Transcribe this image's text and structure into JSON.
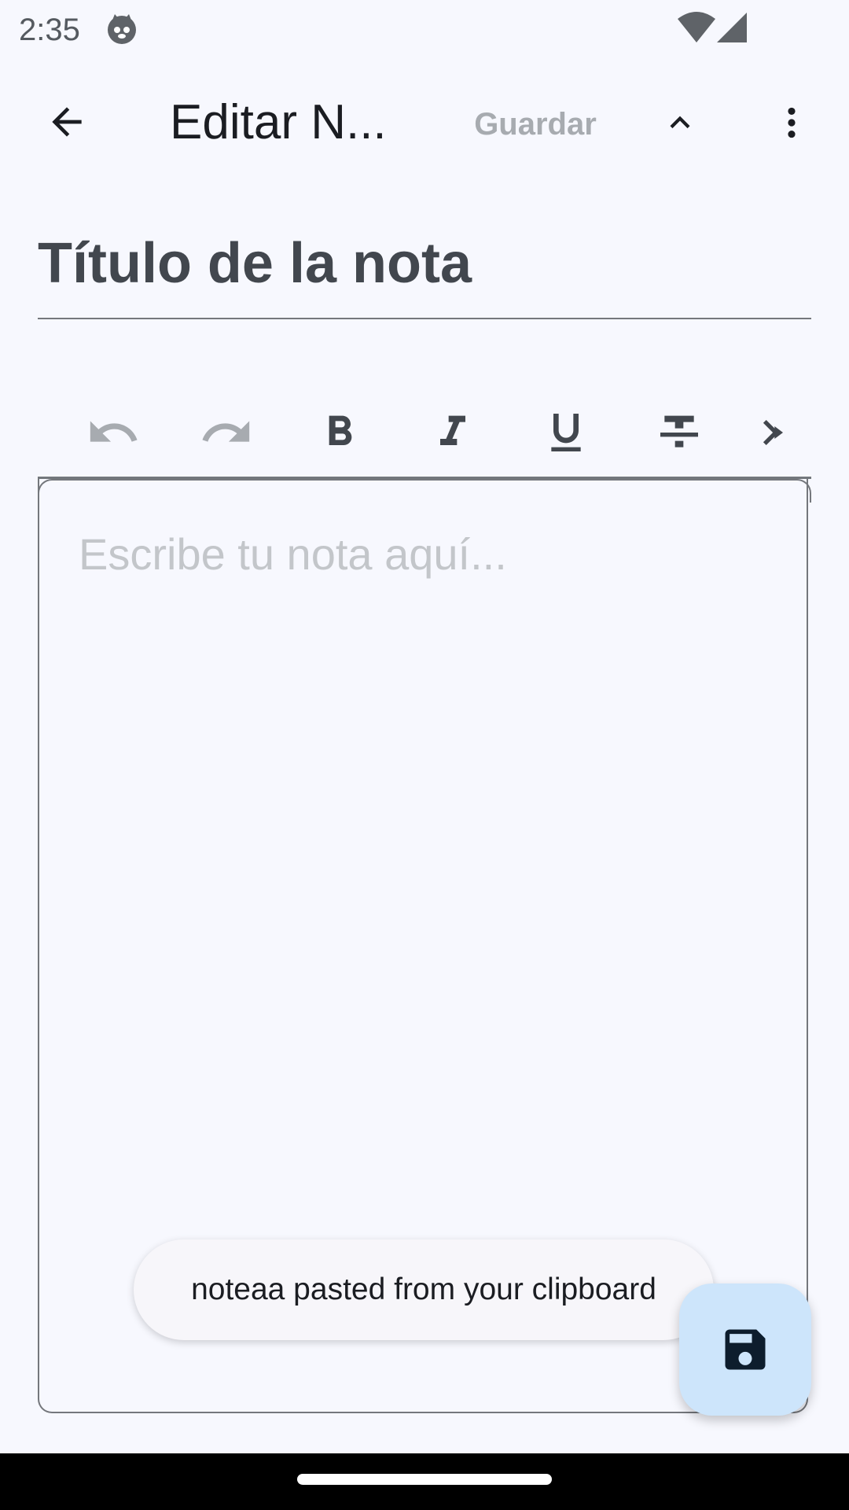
{
  "status_bar": {
    "time": "2:35",
    "app_icon": "cat-face-icon",
    "wifi_icon": "wifi-icon",
    "signal_icon": "cell-signal-icon"
  },
  "app_bar": {
    "back_icon": "arrow-back-icon",
    "title": "Editar N...",
    "save_label": "Guardar",
    "collapse_icon": "chevron-up-icon",
    "more_icon": "more-vert-icon"
  },
  "title_field": {
    "placeholder": "Título de la nota"
  },
  "toolbar": {
    "tools": [
      "undo-icon",
      "redo-icon",
      "bold-icon",
      "italic-icon",
      "underline-icon",
      "strikethrough-icon",
      "more-tools-icon"
    ]
  },
  "editor": {
    "placeholder": "Escribe tu nota aquí..."
  },
  "toast": {
    "message": "noteaa pasted from your clipboard"
  },
  "fab": {
    "icon": "save-icon"
  },
  "colors": {
    "background": "#f7f8fe",
    "fab_background": "#cde5fb",
    "icon_dark": "#42474e",
    "icon_disabled": "#a7abb0"
  }
}
